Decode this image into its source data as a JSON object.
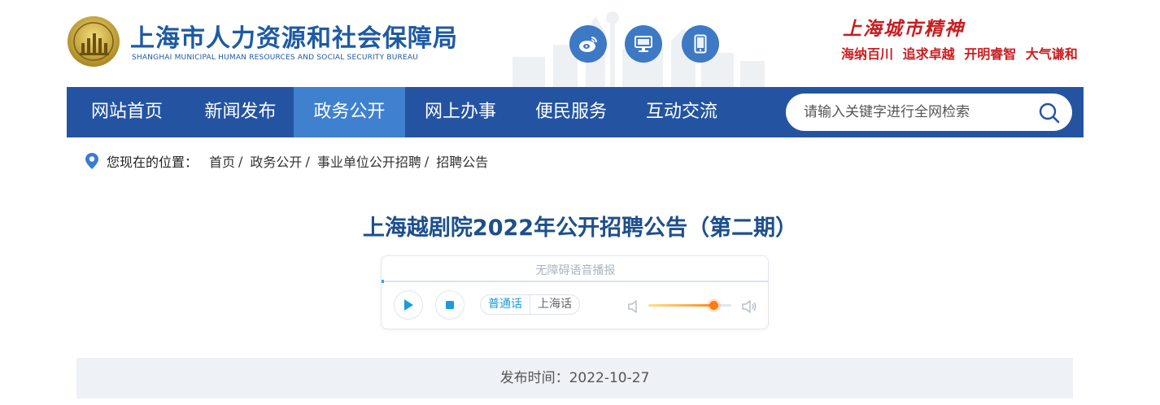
{
  "header": {
    "title_cn": "上海市人力资源和社会保障局",
    "title_en": "SHANGHAI MUNICIPAL HUMAN RESOURCES AND SOCIAL SECURITY BUREAU",
    "social_icons": [
      "weibo-icon",
      "computer-icon",
      "mobile-icon"
    ],
    "spirit_title": "上海城市精神",
    "spirit_words": [
      "海纳百川",
      "追求卓越",
      "开明睿智",
      "大气谦和"
    ]
  },
  "nav": {
    "items": [
      {
        "label": "网站首页",
        "active": false
      },
      {
        "label": "新闻发布",
        "active": false
      },
      {
        "label": "政务公开",
        "active": true
      },
      {
        "label": "网上办事",
        "active": false
      },
      {
        "label": "便民服务",
        "active": false
      },
      {
        "label": "互动交流",
        "active": false
      }
    ],
    "search_placeholder": "请输入关键字进行全网检索"
  },
  "breadcrumb": {
    "prefix": "您现在的位置：",
    "items": [
      "首页",
      "政务公开",
      "事业单位公开招聘",
      "招聘公告"
    ],
    "separator": "/"
  },
  "article": {
    "title": "上海越剧院2022年公开招聘公告（第二期）",
    "publish_label": "发布时间：2022-10-27"
  },
  "player": {
    "label": "无障碍语音播报",
    "languages": [
      {
        "label": "普通话",
        "active": true
      },
      {
        "label": "上海话",
        "active": false
      }
    ],
    "volume": 0.78
  },
  "colors": {
    "nav_bg": "#2454a1",
    "nav_active": "#3f80cf",
    "brand_blue": "#1d5aa3",
    "spirit_red": "#c91d20",
    "title_blue": "#1d4f8c"
  }
}
